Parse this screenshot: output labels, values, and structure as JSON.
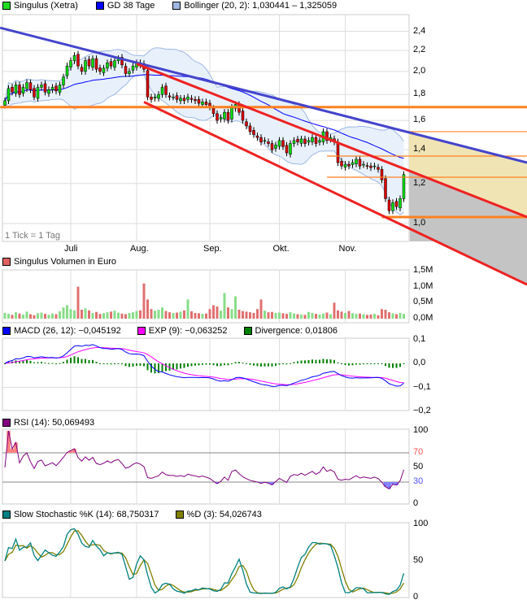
{
  "colors": {
    "up": "#00dd00",
    "down": "#dd0000",
    "sma": "#0000ff",
    "boll_fill": "#e8f0fc",
    "boll_line": "#9db8e4",
    "blue_trend": "#4444cc",
    "red_trend": "#ee2222",
    "orange": "#ff8020",
    "beige": "#f0e4b4",
    "gray": "#c4c4c4",
    "macd": "#0000ff",
    "exp": "#ff00ff",
    "divergence": "#008000",
    "rsi": "#800080",
    "stoch_k": "#008080",
    "stoch_d": "#808000",
    "vol_up": "#88dd88",
    "vol_down": "#e07070",
    "grid": "#dddddd"
  },
  "legends": {
    "price": [
      {
        "label": "Singulus (Xetra)",
        "color": "#22dd22"
      },
      {
        "label": "GD 38 Tage",
        "color": "#0000ff"
      },
      {
        "label": "Bollinger (20, 2): 1,030441 – 1,325059",
        "color": "#a0b8e0"
      }
    ],
    "volume": [
      {
        "label": "Singulus Volumen in Euro",
        "color": "#e06060"
      }
    ],
    "macd": [
      {
        "label": "MACD (26, 12): −0,045192",
        "color": "#0000ff"
      },
      {
        "label": "EXP (9): −0,063252",
        "color": "#ff00ff"
      },
      {
        "label": "Divergence: 0,01806",
        "color": "#008000"
      }
    ],
    "rsi": [
      {
        "label": "RSI (14): 50,069493",
        "color": "#800080"
      }
    ],
    "stoch": [
      {
        "label": "Slow Stochastic %K (14): 68,750317",
        "color": "#008080"
      },
      {
        "label": "%D (3): 54,026743",
        "color": "#808000"
      }
    ]
  },
  "tick_note": "1 Tick = 1 Tag",
  "chart_data": {
    "type": "candlestick",
    "xticks": [
      {
        "label": "Juli",
        "index": 18
      },
      {
        "label": "Aug.",
        "index": 36
      },
      {
        "label": "Sep.",
        "index": 56
      },
      {
        "label": "Okt.",
        "index": 75
      },
      {
        "label": "Nov.",
        "index": 93
      }
    ],
    "price_axis": [
      {
        "label": "2,4",
        "value": 2.4
      },
      {
        "label": "2,2",
        "value": 2.2
      },
      {
        "label": "2,0",
        "value": 2.0
      },
      {
        "label": "1,8",
        "value": 1.8
      },
      {
        "label": "1,6",
        "value": 1.6
      },
      {
        "label": "1,4",
        "value": 1.4
      },
      {
        "label": "1,2",
        "value": 1.2
      },
      {
        "label": "1,0",
        "value": 1.0
      }
    ],
    "closes": [
      1.75,
      1.85,
      1.82,
      1.88,
      1.8,
      1.86,
      1.9,
      1.84,
      1.78,
      1.86,
      1.88,
      1.82,
      1.84,
      1.86,
      1.83,
      1.88,
      1.95,
      2.05,
      2.1,
      2.15,
      2.05,
      2.0,
      2.1,
      2.05,
      2.12,
      2.02,
      2.0,
      2.03,
      2.08,
      2.05,
      2.1,
      2.12,
      2.06,
      1.98,
      2.0,
      2.05,
      2.08,
      2.06,
      2.02,
      1.78,
      1.76,
      1.78,
      1.8,
      1.86,
      1.8,
      1.78,
      1.78,
      1.76,
      1.77,
      1.75,
      1.78,
      1.76,
      1.75,
      1.73,
      1.74,
      1.72,
      1.7,
      1.65,
      1.6,
      1.62,
      1.66,
      1.6,
      1.7,
      1.72,
      1.66,
      1.6,
      1.56,
      1.52,
      1.5,
      1.48,
      1.45,
      1.46,
      1.44,
      1.4,
      1.43,
      1.46,
      1.42,
      1.38,
      1.44,
      1.46,
      1.45,
      1.47,
      1.44,
      1.46,
      1.48,
      1.44,
      1.46,
      1.52,
      1.46,
      1.48,
      1.45,
      1.32,
      1.3,
      1.31,
      1.3,
      1.32,
      1.34,
      1.3,
      1.31,
      1.3,
      1.29,
      1.3,
      1.28,
      1.22,
      1.12,
      1.06,
      1.1,
      1.08,
      1.12,
      1.25
    ],
    "volume_k": [
      180,
      150,
      120,
      200,
      160,
      130,
      220,
      140,
      110,
      170,
      190,
      150,
      120,
      160,
      140,
      230,
      350,
      420,
      300,
      260,
      1000,
      280,
      320,
      260,
      180,
      210,
      150,
      170,
      200,
      220,
      250,
      190,
      160,
      140,
      180,
      200,
      240,
      260,
      1100,
      600,
      300,
      250,
      280,
      350,
      240,
      200,
      180,
      190,
      220,
      260,
      600,
      230,
      180,
      170,
      150,
      160,
      300,
      420,
      380,
      250,
      800,
      350,
      300,
      700,
      280,
      240,
      220,
      200,
      180,
      300,
      600,
      250,
      200,
      210,
      180,
      190,
      170,
      150,
      200,
      160,
      140,
      130,
      120,
      210,
      180,
      150,
      130,
      160,
      190,
      140,
      500,
      260,
      220,
      180,
      240,
      170,
      150,
      160,
      140,
      120,
      130,
      150,
      110,
      300,
      280,
      200,
      170,
      140,
      180,
      150
    ],
    "volume_axis": [
      {
        "label": "1,5M",
        "value": 1500
      },
      {
        "label": "1,0M",
        "value": 1000
      },
      {
        "label": "0,5M",
        "value": 500
      },
      {
        "label": "0,0M",
        "value": 0
      }
    ],
    "macd_axis": [
      {
        "label": "0,1",
        "value": 0.1
      },
      {
        "label": "0,0",
        "value": 0
      },
      {
        "label": "−0,1",
        "value": -0.1
      },
      {
        "label": "−0,2",
        "value": -0.2
      }
    ],
    "rsi_axis": [
      {
        "label": "100",
        "value": 100
      },
      {
        "label": "70",
        "value": 70,
        "color": "#ff5050"
      },
      {
        "label": "50",
        "value": 50
      },
      {
        "label": "30",
        "value": 30,
        "color": "#5050ff"
      },
      {
        "label": "0",
        "value": 0
      }
    ],
    "stoch_axis": [
      {
        "label": "100",
        "value": 100
      },
      {
        "label": "50",
        "value": 50
      },
      {
        "label": "0",
        "value": 0
      }
    ],
    "trendlines": [
      {
        "name": "blue-resistance",
        "color": "blue_trend",
        "from": {
          "index": -1.3,
          "price": 2.44
        },
        "to": {
          "index": 142.7,
          "price": 1.32
        }
      },
      {
        "name": "red-channel-upper",
        "color": "red_trend",
        "from": {
          "index": 36,
          "price": 2.07
        },
        "to": {
          "index": 142.7,
          "price": 1.03
        }
      },
      {
        "name": "red-channel-lower",
        "color": "red_trend",
        "from": {
          "index": 38,
          "price": 1.74
        },
        "to": {
          "index": 142.7,
          "price": 0.757
        }
      }
    ],
    "levels": [
      {
        "price": 1.7,
        "from": -1.3,
        "thick": true
      },
      {
        "price": 1.03,
        "from": 103,
        "thick": true
      },
      {
        "price": 1.52,
        "from": 110,
        "thick": false
      },
      {
        "price": 1.36,
        "from": 88,
        "thick": false
      },
      {
        "price": 1.235,
        "from": 88,
        "thick": false
      }
    ]
  }
}
